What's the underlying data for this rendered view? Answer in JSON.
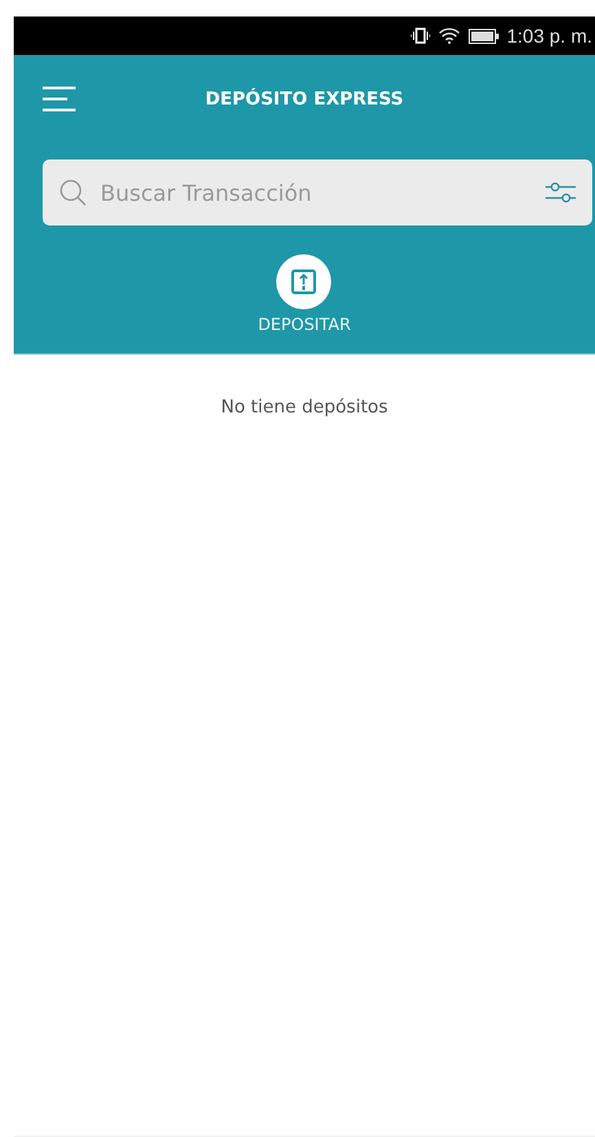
{
  "status_bar": {
    "time": "1:03 p. m."
  },
  "header": {
    "title": "DEPÓSITO EXPRESS"
  },
  "search": {
    "placeholder": "Buscar Transacción"
  },
  "action": {
    "label": "DEPOSITAR"
  },
  "empty_message": "No tiene depósitos"
}
